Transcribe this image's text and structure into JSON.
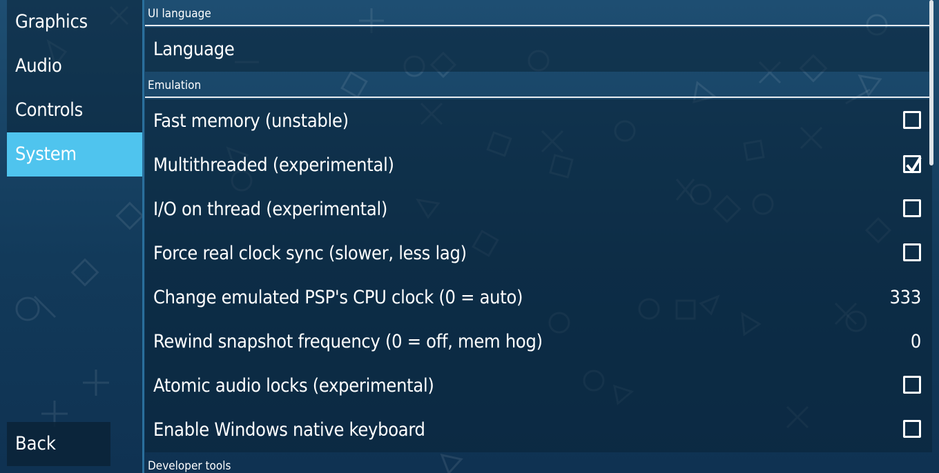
{
  "tabs": [
    {
      "label": "Graphics"
    },
    {
      "label": "Audio"
    },
    {
      "label": "Controls"
    },
    {
      "label": "System"
    }
  ],
  "active_tab": "System",
  "back_label": "Back",
  "sections": {
    "ui_language": {
      "header": "UI language",
      "language_label": "Language"
    },
    "emulation": {
      "header": "Emulation",
      "items": [
        {
          "label": "Fast memory (unstable)",
          "type": "checkbox",
          "checked": false
        },
        {
          "label": "Multithreaded (experimental)",
          "type": "checkbox",
          "checked": true
        },
        {
          "label": "I/O on thread (experimental)",
          "type": "checkbox",
          "checked": false
        },
        {
          "label": "Force real clock sync (slower, less lag)",
          "type": "checkbox",
          "checked": false
        },
        {
          "label": "Change emulated PSP's CPU clock (0 = auto)",
          "type": "value",
          "value": "333"
        },
        {
          "label": "Rewind snapshot frequency (0 = off, mem hog)",
          "type": "value",
          "value": "0"
        },
        {
          "label": "Atomic audio locks (experimental)",
          "type": "checkbox",
          "checked": false
        },
        {
          "label": "Enable Windows native keyboard",
          "type": "checkbox",
          "checked": false
        }
      ]
    },
    "developer_tools": {
      "header": "Developer tools"
    }
  },
  "colors": {
    "accent": "#4fc4ee",
    "background_top": "#1e4e72",
    "background_bottom": "#0f3252",
    "panel": "#0a2337"
  }
}
